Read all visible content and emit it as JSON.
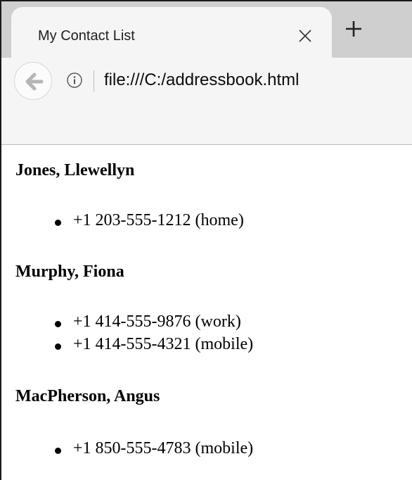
{
  "browser": {
    "tab_title": "My Contact List",
    "url": "file:///C:/addressbook.html",
    "icons": {
      "close": "close-icon",
      "new_tab": "plus-icon",
      "back": "back-arrow-icon",
      "info": "info-icon"
    }
  },
  "contacts": [
    {
      "name": "Jones, Llewellyn",
      "phones": [
        {
          "text": "+1 203-555-1212 (home)"
        }
      ]
    },
    {
      "name": "Murphy, Fiona",
      "phones": [
        {
          "text": "+1 414-555-9876 (work)"
        },
        {
          "text": "+1 414-555-4321 (mobile)"
        }
      ]
    },
    {
      "name": "MacPherson, Angus",
      "phones": [
        {
          "text": "+1 850-555-4783 (mobile)"
        }
      ]
    }
  ]
}
